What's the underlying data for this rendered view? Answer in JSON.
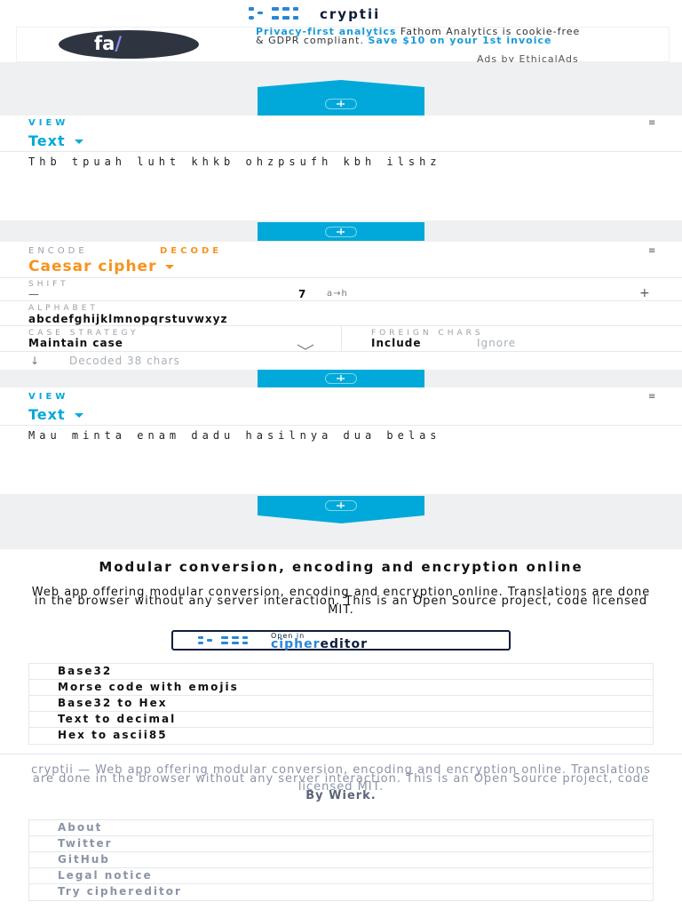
{
  "header": {
    "logo_text": "cryptii"
  },
  "ad": {
    "logo_text": "fa",
    "headline": "Privacy-first analytics",
    "body_text": " Fathom Analytics is cookie-free & GDPR compliant. ",
    "cta": "Save $10 on your 1st invoice",
    "by": "Ads by EthicalAds"
  },
  "view1": {
    "label": "VIEW",
    "title": "Text",
    "content": "Thb tpuah luht khkb ohzpsufh kbh ilshz"
  },
  "encoder": {
    "mode_encode": "ENCODE",
    "mode_decode": "DECODE",
    "title": "Caesar cipher",
    "shift_label": "SHIFT",
    "shift_value": "7",
    "shift_mapping": "a→h",
    "minus": "—",
    "plus": "+",
    "alphabet_label": "ALPHABET",
    "alphabet_value": "abcdefghijklmnopqrstuvwxyz",
    "case_label": "CASE STRATEGY",
    "case_value": "Maintain case",
    "foreign_label": "FOREIGN CHARS",
    "foreign_include": "Include",
    "foreign_ignore": "Ignore",
    "status": "Decoded 38 chars"
  },
  "view2": {
    "label": "VIEW",
    "title": "Text",
    "content": "Mau minta enam dadu hasilnya dua belas"
  },
  "about": {
    "heading": "Modular conversion, encoding and encryption online",
    "description": "Web app offering modular conversion, encoding and encryption online. Translations are done in the browser without any server interaction. This is an Open Source project, code licensed MIT.",
    "button_small": "Open in",
    "button_big_a": "cipher",
    "button_big_b": "editor"
  },
  "links": [
    "Base32",
    "Morse code with emojis",
    "Base32 to Hex",
    "Text to decimal",
    "Hex to ascii85"
  ],
  "footer": {
    "text": "cryptii — Web app offering modular conversion, encoding and encryption online. Translations are done in the browser without any server interaction. This is an Open Source project, code licensed MIT.",
    "by": "By Wierk.",
    "items": [
      "About",
      "Twitter",
      "GitHub",
      "Legal notice",
      "Try ciphereditor"
    ]
  },
  "colors": {
    "accent": "#00a9d9",
    "orange": "#f7931e",
    "navy": "#0e1e3c",
    "gap": "#eef0f2"
  }
}
